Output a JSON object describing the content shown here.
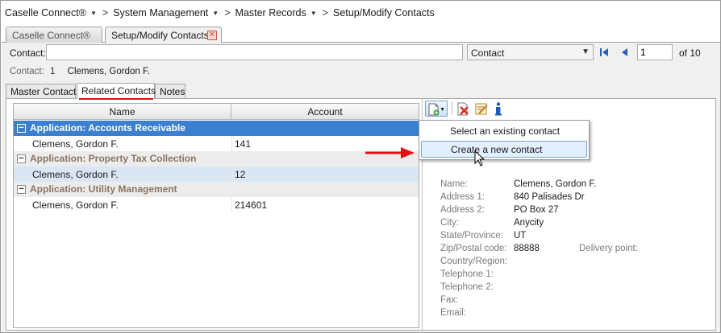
{
  "breadcrumb": [
    "Caselle Connect®",
    "System Management",
    "Master Records",
    "Setup/Modify Contacts"
  ],
  "tabs": {
    "home": "Caselle Connect®",
    "current": "Setup/Modify Contacts",
    "close_glyph": "✕"
  },
  "contact": {
    "label": "Contact:",
    "value": "",
    "search_by": "Contact",
    "page": "1",
    "of_total": "of 10"
  },
  "summary": {
    "label": "Contact:",
    "count": "1",
    "name": "Clemens, Gordon F."
  },
  "subtabs": [
    "Master Contact",
    "Related Contacts",
    "Notes"
  ],
  "grid": {
    "columns": [
      "Name",
      "Account"
    ],
    "groups": [
      {
        "title": "Application: Accounts Receivable",
        "rows": [
          {
            "name": "Clemens, Gordon F.",
            "account": "141"
          }
        ]
      },
      {
        "title": "Application: Property Tax Collection",
        "rows": [
          {
            "name": "Clemens, Gordon F.",
            "account": "12"
          }
        ]
      },
      {
        "title": "Application: Utility Management",
        "rows": [
          {
            "name": "Clemens, Gordon F.",
            "account": "214601"
          }
        ]
      }
    ]
  },
  "menu": {
    "items": [
      "Select an existing contact",
      "Create a new contact"
    ],
    "highlighted": "Create a new contact"
  },
  "details": {
    "name_label": "Name:",
    "name": "Clemens, Gordon F.",
    "address1_label": "Address 1:",
    "address1": "840 Palisades Dr",
    "address2_label": "Address 2:",
    "address2": "PO Box 27",
    "city_label": "City:",
    "city": "Anycity",
    "state_label": "State/Province:",
    "state": "UT",
    "zip_label": "Zip/Postal code:",
    "zip": "88888",
    "delivery_label": "Delivery point:",
    "country_label": "Country/Region:",
    "tel1_label": "Telephone 1:",
    "tel2_label": "Telephone 2:",
    "fax_label": "Fax:",
    "email_label": "Email:"
  },
  "colors": {
    "selected_group": "#3b7fd1",
    "group_text": "#8a7560",
    "annotation": "#e01010"
  }
}
